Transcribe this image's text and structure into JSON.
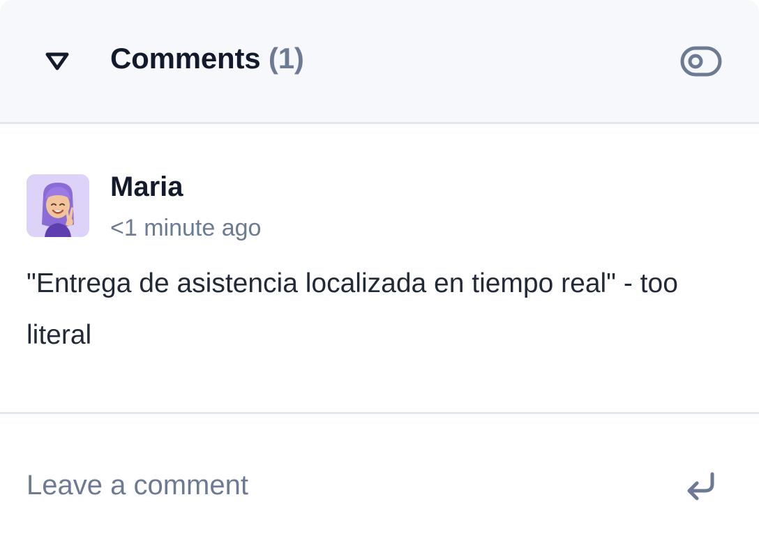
{
  "header": {
    "title": "Comments",
    "count": "(1)",
    "collapse_icon": "triangle-down-icon",
    "visibility_icon": "toggle-eye-icon"
  },
  "comments": [
    {
      "author": "Maria",
      "time": "<1 minute ago",
      "text": "\"Entrega de asistencia localizada en tiempo real\" - too literal",
      "avatar_icon": "memoji-avatar"
    }
  ],
  "composer": {
    "placeholder": "Leave a comment",
    "value": "",
    "send_icon": "enter-return-icon"
  },
  "colors": {
    "header_bg": "#f6f8fb",
    "divider": "#e3e7ee",
    "primary_text": "#131a2b",
    "muted_text": "#6c7a93",
    "avatar_bg": "#ddd3f8"
  }
}
